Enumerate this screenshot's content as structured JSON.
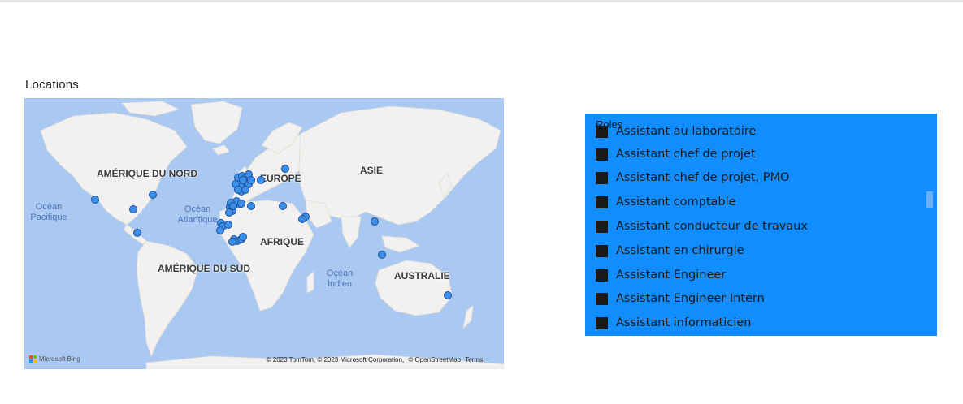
{
  "map": {
    "title": "Locations",
    "continent_labels": {
      "north_america": "AMÉRIQUE DU NORD",
      "europe": "EUROPE",
      "asia": "ASIE",
      "africa": "AFRIQUE",
      "south_america": "AMÉRIQUE DU SUD",
      "australia": "AUSTRALIE"
    },
    "ocean_labels": {
      "pacific": "Océan\nPacifique",
      "atlantic": "Océan\nAtlantique",
      "indian": "Océan\nIndien"
    },
    "provider": "Microsoft Bing",
    "attribution": "© 2023 TomTom, © 2023 Microsoft Corporation,",
    "osm_link": "© OpenStreetMap",
    "terms_link": "Terms",
    "colors": {
      "water": "#a9c8f2",
      "land": "#f2f1ef",
      "marker_fill": "#3d8ee8",
      "marker_stroke": "#1a4f9a"
    }
  },
  "roles_slicer": {
    "title": "Roles",
    "partial_top_item": "Assistant au laboratoire",
    "items": [
      "Assistant chef de projet",
      "Assistant chef de projet, PMO",
      "Assistant comptable",
      "Assistant conducteur de travaux",
      "Assistant en chirurgie",
      "Assistant Engineer",
      "Assistant Engineer Intern",
      "Assistant informaticien"
    ],
    "colors": {
      "background": "#118dff",
      "checkbox": "#1a1a1a",
      "text": "#1a1a1a"
    }
  }
}
